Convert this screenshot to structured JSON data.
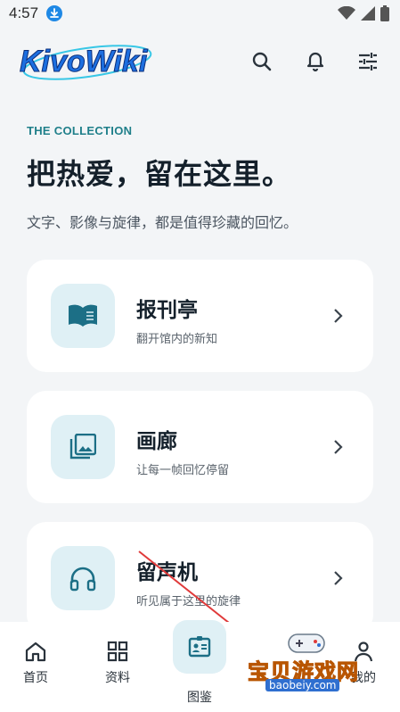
{
  "status_bar": {
    "time": "4:57"
  },
  "header": {
    "logo_text": "KivoWiki"
  },
  "hero": {
    "eyebrow": "THE COLLECTION",
    "headline": "把热爱，留在这里。",
    "subtitle": "文字、影像与旋律，都是值得珍藏的回忆。"
  },
  "cards": [
    {
      "title": "报刊亭",
      "desc": "翻开馆内的新知",
      "icon": "book-icon"
    },
    {
      "title": "画廊",
      "desc": "让每一帧回忆停留",
      "icon": "gallery-icon"
    },
    {
      "title": "留声机",
      "desc": "听见属于这里的旋律",
      "icon": "headphones-icon"
    }
  ],
  "nav": {
    "items": [
      {
        "label": "首页",
        "icon": "home-icon"
      },
      {
        "label": "资料",
        "icon": "grid-icon"
      },
      {
        "label": "图鉴",
        "icon": "id-card-icon"
      },
      {
        "label": "我的",
        "icon": "user-icon"
      }
    ]
  },
  "watermark": {
    "text": "宝贝游戏网",
    "url": "baobeiy.com"
  },
  "colors": {
    "accent": "#1f7f8a",
    "tile_bg": "#dff0f5",
    "page_bg": "#f3f5f7"
  }
}
